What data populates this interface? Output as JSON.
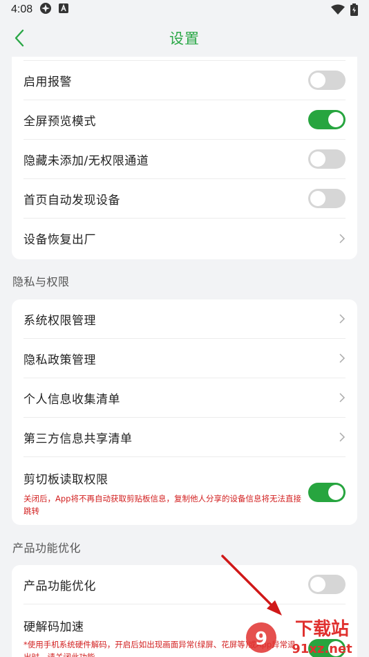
{
  "status_bar": {
    "time": "4:08"
  },
  "header": {
    "title": "设置"
  },
  "card1": {
    "rows": [
      {
        "label": "启用报警",
        "toggle": "off"
      },
      {
        "label": "全屏预览模式",
        "toggle": "on"
      },
      {
        "label": "隐藏未添加/无权限通道",
        "toggle": "off"
      },
      {
        "label": "首页自动发现设备",
        "toggle": "off"
      },
      {
        "label": "设备恢复出厂",
        "type": "link"
      }
    ]
  },
  "privacy": {
    "section_title": "隐私与权限",
    "rows": [
      {
        "label": "系统权限管理"
      },
      {
        "label": "隐私政策管理"
      },
      {
        "label": "个人信息收集清单"
      },
      {
        "label": "第三方信息共享清单"
      }
    ],
    "clipboard": {
      "label": "剪切板读取权限",
      "note": "关闭后，App将不再自动获取剪贴板信息，复制他人分享的设备信息将无法直接跳转",
      "toggle": "on"
    }
  },
  "product": {
    "section_title": "产品功能优化",
    "rows": [
      {
        "label": "产品功能优化",
        "toggle": "off"
      }
    ],
    "hw_decode": {
      "label": "硬解码加速",
      "note": "*使用手机系统硬件解码，开启后如出现画面异常(绿屏、花屏等)或App异常退出时，请关闭此功能",
      "toggle": "on"
    }
  },
  "watermark": {
    "text1": "下载站",
    "text2": "91xz.net"
  },
  "colors": {
    "accent": "#27a53f",
    "title": "#2aa746",
    "warning": "#d21f1f",
    "background": "#f2f3f5"
  }
}
